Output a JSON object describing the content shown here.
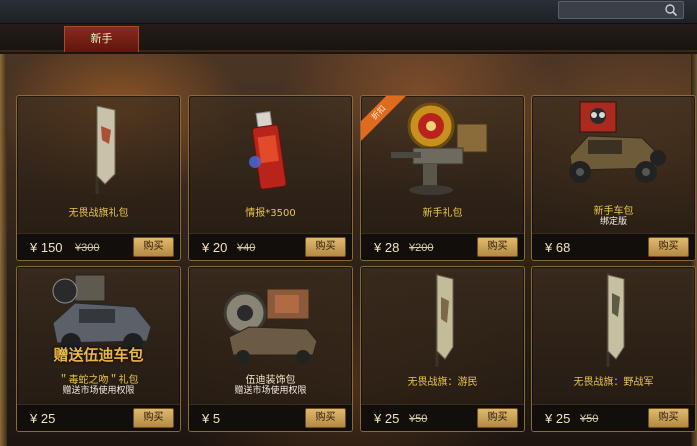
{
  "tabs": [
    {
      "label": "新手"
    }
  ],
  "buy_label": "购买",
  "cards": [
    {
      "name": "无畏战旗礼包",
      "price": "¥ 150",
      "old_price": "¥300"
    },
    {
      "name": "情报*3500",
      "price": "¥ 20",
      "old_price": "¥40"
    },
    {
      "name": "新手礼包",
      "price": "¥ 28",
      "old_price": "¥200",
      "badge": "折扣"
    },
    {
      "name": "新手车包",
      "sub": "绑定版",
      "price": "¥ 68"
    },
    {
      "name": "＂毒蛇之吻＂礼包",
      "sub": "赠送市场使用权限",
      "overlay": "赠送伍迪车包",
      "price": "¥ 25"
    },
    {
      "name": "伍迪装饰包",
      "sub": "赠送市场使用权限",
      "price": "¥ 5"
    },
    {
      "name": "无畏战旗：游民",
      "price": "¥ 25",
      "old_price": "¥50"
    },
    {
      "name": "无畏战旗：野战军",
      "price": "¥ 25",
      "old_price": "¥50"
    }
  ],
  "colors": {
    "accent": "#e6c44a",
    "buy": "#d4a85a",
    "tab_active": "#7a2418",
    "badge": "#e06a1e"
  },
  "icons": [
    "search-icon",
    "banner-icon",
    "usb-drive-icon",
    "turret-icon",
    "armored-car-icon",
    "gas-mask-car-icon",
    "decoration-kit-icon"
  ]
}
